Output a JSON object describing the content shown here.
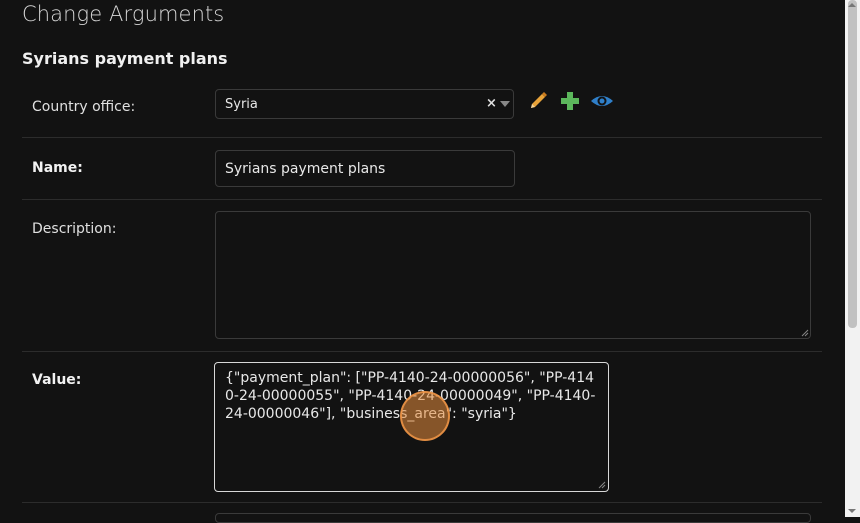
{
  "page": {
    "title": "Change Arguments"
  },
  "section": {
    "title": "Syrians payment plans"
  },
  "fields": {
    "country_office": {
      "label": "Country office:",
      "value": "Syria",
      "clear_symbol": "×"
    },
    "name": {
      "label": "Name:",
      "value": "Syrians payment plans"
    },
    "description": {
      "label": "Description:",
      "value": ""
    },
    "value": {
      "label": "Value:",
      "value": "{\"payment_plan\": [\"PP-4140-24-00000056\", \"PP-4140-24-00000055\", \"PP-4140-24-00000049\", \"PP-4140-24-00000046\"], \"business_area\": \"syria\"}"
    }
  },
  "icons": {
    "edit": {
      "name": "pencil-icon",
      "color": "#e8a33a"
    },
    "add": {
      "name": "plus-icon",
      "color": "#5cb85c"
    },
    "view": {
      "name": "eye-icon",
      "color": "#2f7fc9"
    }
  },
  "colors": {
    "background": "#121212",
    "focus_border": "#d8d8d8",
    "cursor_highlight": "#e68c3c"
  }
}
